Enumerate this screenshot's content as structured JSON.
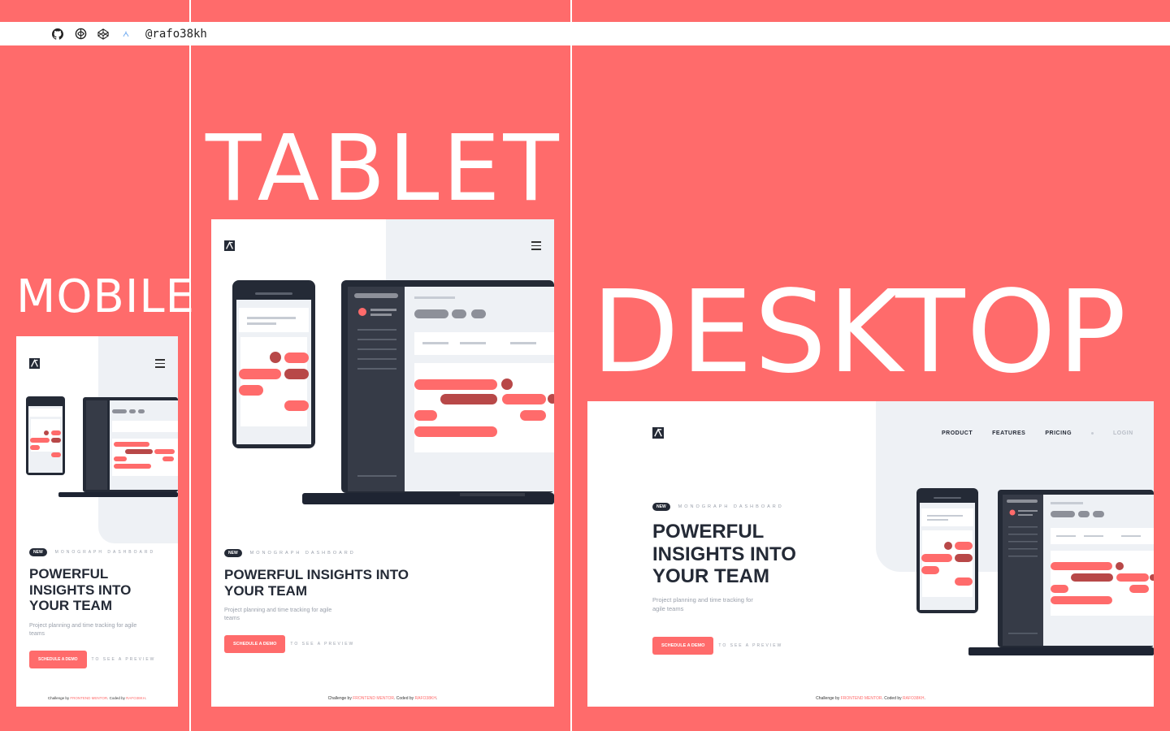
{
  "topbar": {
    "icons": [
      "github-icon",
      "frontend-mentor-icon",
      "codepen-icon",
      "dev-icon"
    ],
    "handle": "@rafo38kh"
  },
  "labels": {
    "mobile": "MOBILE",
    "tablet": "TABLET",
    "desktop": "DESKTOP"
  },
  "site": {
    "badge": "NEW",
    "eyebrow": "MONOGRAPH DASHBOARD",
    "headline": "POWERFUL INSIGHTS INTO YOUR TEAM",
    "subtext": "Project planning and time tracking for agile teams",
    "cta_label": "SCHEDULE A DEMO",
    "cta_hint": "TO SEE A PREVIEW",
    "footer_prefix": "Challenge by",
    "footer_link1": "FRONTEND MENTOR",
    "footer_mid": ". Coded by",
    "footer_link2": "RAFO38KH",
    "footer_suffix": "."
  },
  "nav": {
    "product": "PRODUCT",
    "features": "FEATURES",
    "pricing": "PRICING",
    "login": "LOGIN"
  },
  "colors": {
    "accent": "#ff6b6b",
    "dark": "#242a36",
    "muted": "#9aa0ab",
    "panel": "#eef1f5"
  }
}
